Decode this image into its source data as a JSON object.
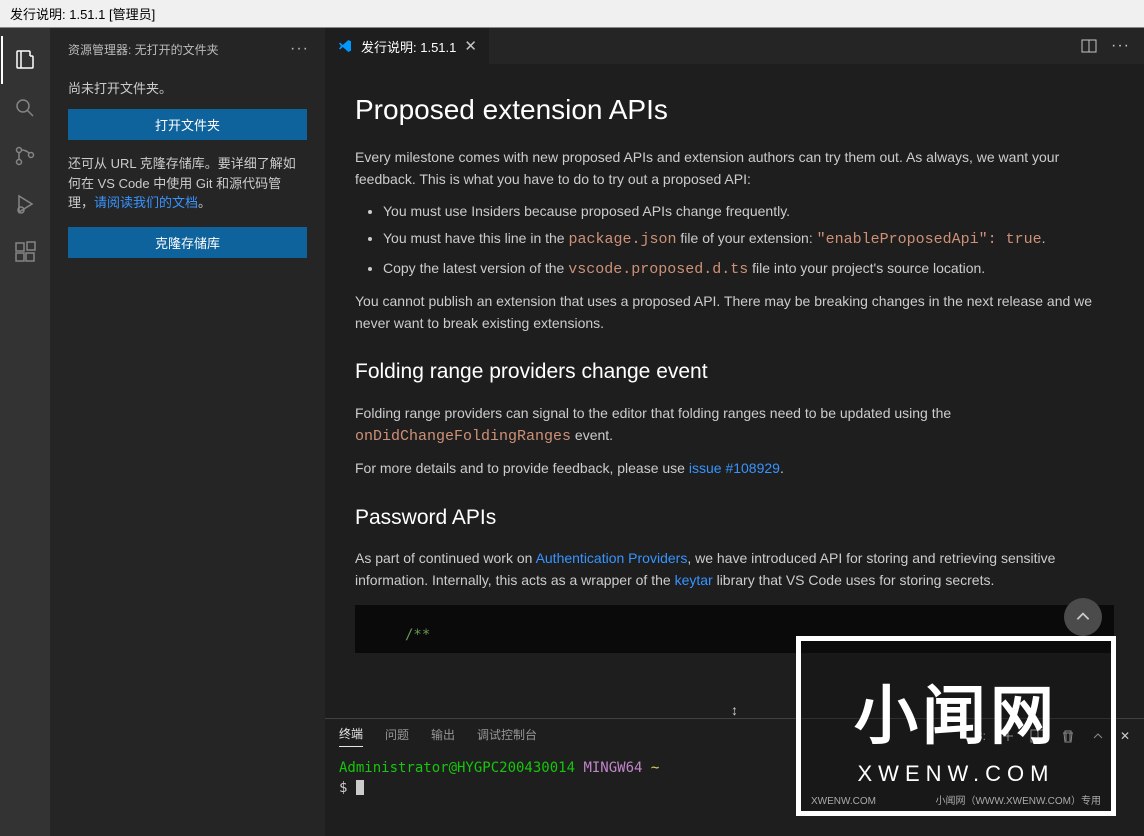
{
  "window": {
    "title": "发行说明: 1.51.1 [管理员]"
  },
  "sidebar": {
    "header": "资源管理器: 无打开的文件夹",
    "noFolderMsg": "尚未打开文件夹。",
    "openFolderBtn": "打开文件夹",
    "cloneText1": "还可从 URL 克隆存储库。要详细了解如何在 VS Code 中使用 Git 和源代码管理，",
    "cloneLink": "请阅读我们的文档",
    "cloneText2": "。",
    "cloneBtn": "克隆存储库"
  },
  "tab": {
    "label": "发行说明: 1.51.1"
  },
  "content": {
    "h2": "Proposed extension APIs",
    "p1": "Every milestone comes with new proposed APIs and extension authors can try them out. As always, we want your feedback. This is what you have to do to try out a proposed API:",
    "li1": "You must use Insiders because proposed APIs change frequently.",
    "li2a": "You must have this line in the ",
    "li2code1": "package.json",
    "li2b": " file of your extension: ",
    "li2code2": "\"enableProposedApi\": true",
    "li2c": ".",
    "li3a": "Copy the latest version of the ",
    "li3code": "vscode.proposed.d.ts",
    "li3b": " file into your project's source location.",
    "p2": "You cannot publish an extension that uses a proposed API. There may be breaking changes in the next release and we never want to break existing extensions.",
    "h3a": "Folding range providers change event",
    "p3a": "Folding range providers can signal to the editor that folding ranges need to be updated using the ",
    "p3code": "onDidChangeFoldingRanges",
    "p3b": " event.",
    "p4a": "For more details and to provide feedback, please use ",
    "p4link": "issue #108929",
    "p4b": ".",
    "h3b": "Password APIs",
    "p5a": "As part of continued work on ",
    "p5link1": "Authentication Providers",
    "p5b": ", we have introduced API for storing and retrieving sensitive information. Internally, this acts as a wrapper of the ",
    "p5link2": "keytar",
    "p5c": " library that VS Code uses for storing secrets.",
    "codeComment": "/**"
  },
  "panel": {
    "tabs": {
      "terminal": "终端",
      "problems": "问题",
      "output": "输出",
      "debug": "调试控制台"
    },
    "dropdown": "3:",
    "termUser": "Administrator@HYGPC200430014",
    "termSys": "MINGW64",
    "termPath": "~",
    "prompt": "$"
  },
  "watermark": {
    "cn": "小闻网",
    "en": "XWENW.COM",
    "footerLeft": "XWENW.COM",
    "footerRight": "小闻网（WWW.XWENW.COM）专用"
  }
}
